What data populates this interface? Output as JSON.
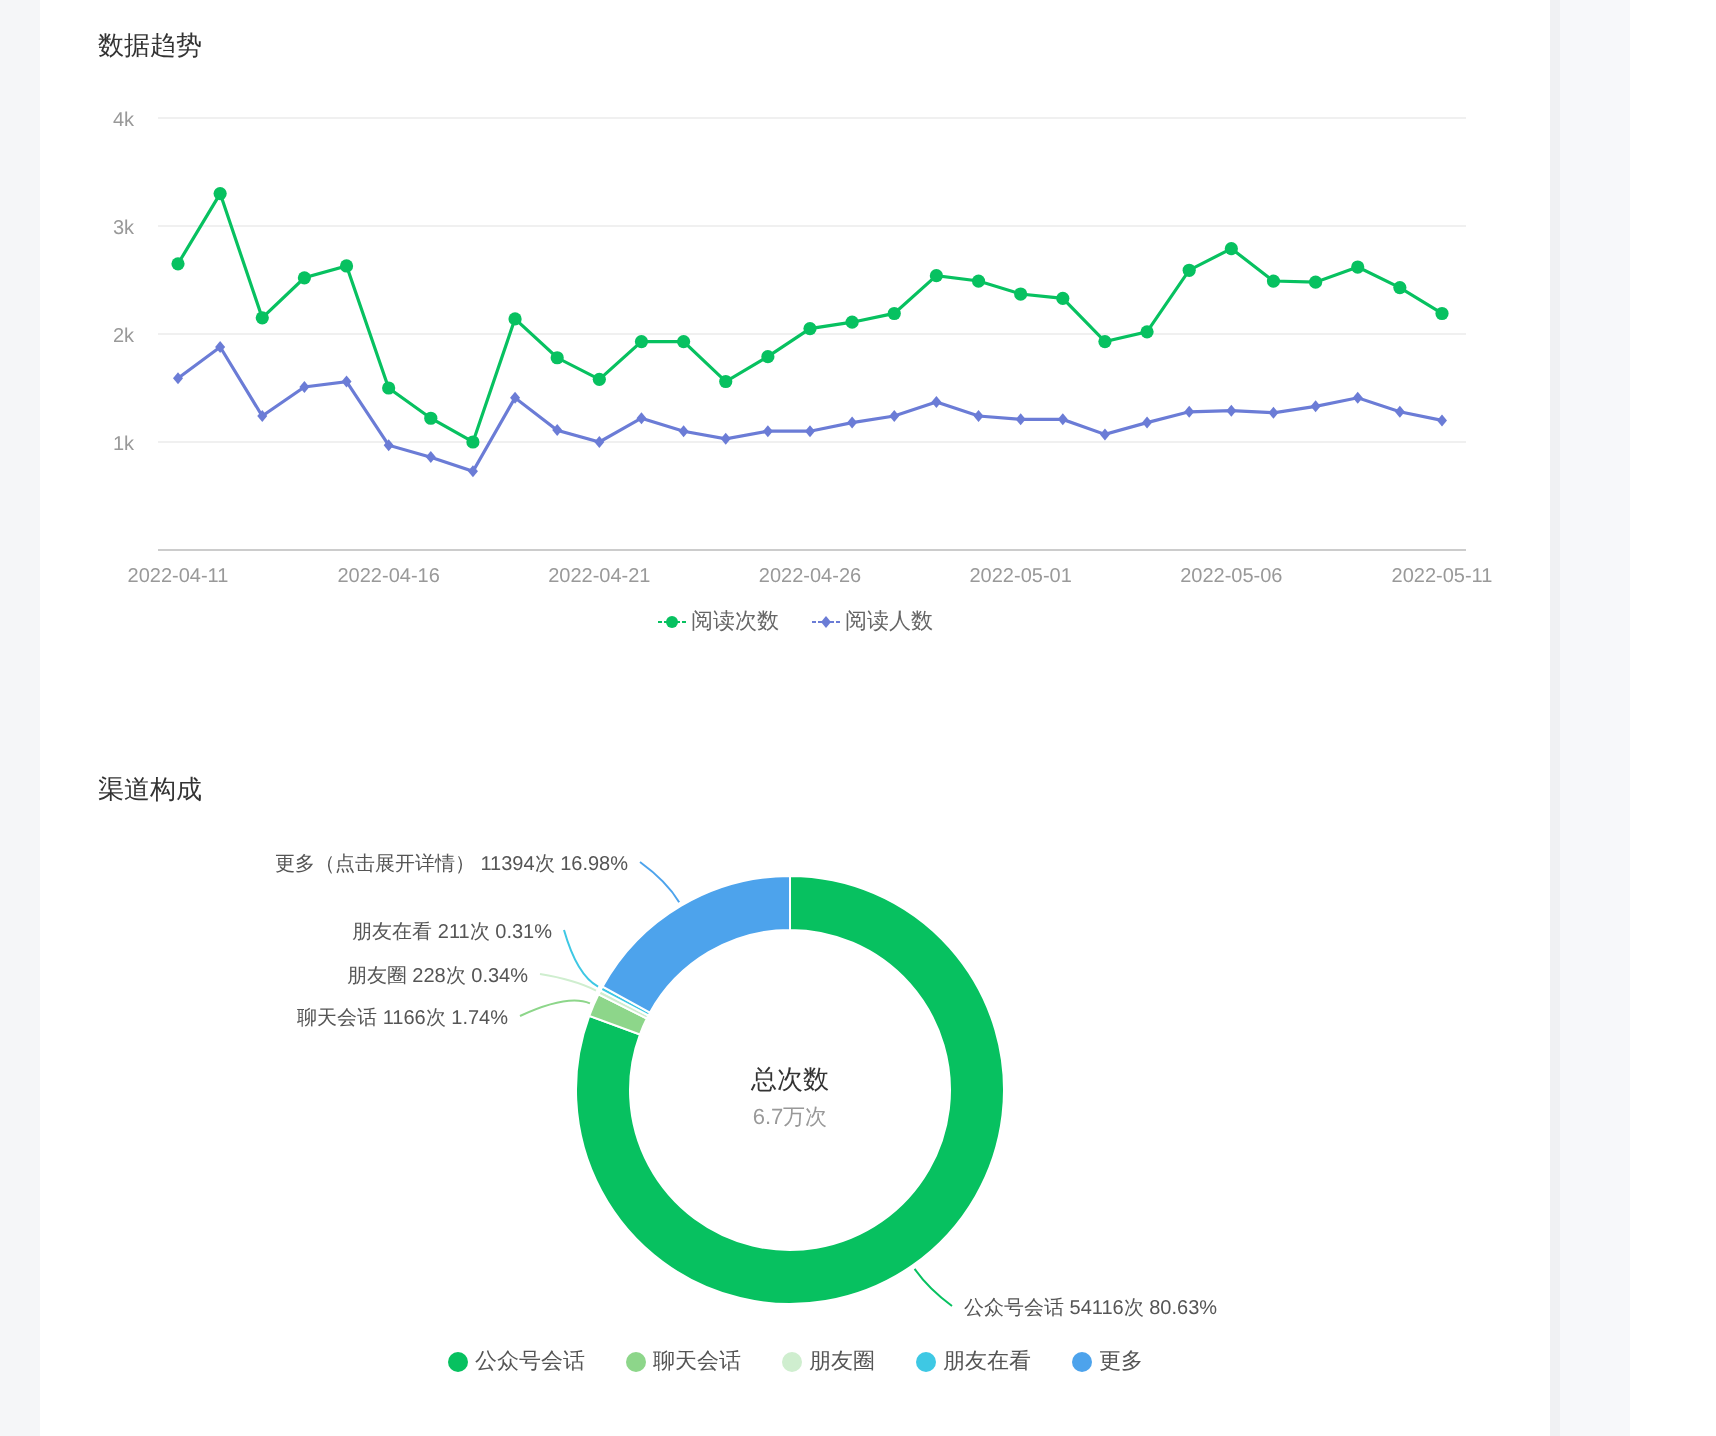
{
  "trend": {
    "title": "数据趋势",
    "chart_data": {
      "type": "line",
      "categories": [
        "2022-04-11",
        null,
        null,
        null,
        null,
        "2022-04-16",
        null,
        null,
        null,
        null,
        "2022-04-21",
        null,
        null,
        null,
        null,
        "2022-04-26",
        null,
        null,
        null,
        null,
        "2022-05-01",
        null,
        null,
        null,
        null,
        "2022-05-06",
        null,
        null,
        null,
        null,
        "2022-05-11"
      ],
      "grid": true,
      "series": [
        {
          "name": "阅读次数",
          "color": "#07c160",
          "marker": "circle",
          "values": [
            2650,
            3300,
            2150,
            2520,
            2630,
            1500,
            1220,
            1000,
            2140,
            1780,
            1580,
            1930,
            1930,
            1560,
            1790,
            2050,
            2110,
            2190,
            2540,
            2490,
            2370,
            2330,
            1930,
            2020,
            2590,
            2790,
            2490,
            2480,
            2620,
            2430,
            2190
          ]
        },
        {
          "name": "阅读人数",
          "color": "#6b7cd6",
          "marker": "diamond",
          "values": [
            1590,
            1880,
            1240,
            1510,
            1560,
            970,
            860,
            730,
            1410,
            1110,
            1000,
            1220,
            1100,
            1030,
            1100,
            1100,
            1180,
            1240,
            1370,
            1240,
            1210,
            1210,
            1070,
            1180,
            1280,
            1290,
            1270,
            1330,
            1410,
            1280,
            1200
          ]
        }
      ],
      "ylim": [
        0,
        4000
      ],
      "yticks": [
        {
          "value": 1000,
          "label": "1k"
        },
        {
          "value": 2000,
          "label": "2k"
        },
        {
          "value": 3000,
          "label": "3k"
        },
        {
          "value": 4000,
          "label": "4k"
        }
      ]
    }
  },
  "channels": {
    "title": "渠道构成",
    "center_title": "总次数",
    "center_value": "6.7万次",
    "chart_data": {
      "type": "donut",
      "categories": [
        "公众号会话",
        "聊天会话",
        "朋友圈",
        "朋友在看",
        "更多"
      ],
      "values": [
        54116,
        1166,
        228,
        211,
        11394
      ],
      "colors": [
        "#07c160",
        "#8dd68a",
        "#cfeecf",
        "#3ec8e4",
        "#4da3ec"
      ],
      "value_labels": [
        "公众号会话 54116次 80.63%",
        "聊天会话 1166次 1.74%",
        "朋友圈 228次 0.34%",
        "朋友在看 211次 0.31%",
        "更多（点击展开详情） 11394次 16.98%"
      ]
    }
  }
}
